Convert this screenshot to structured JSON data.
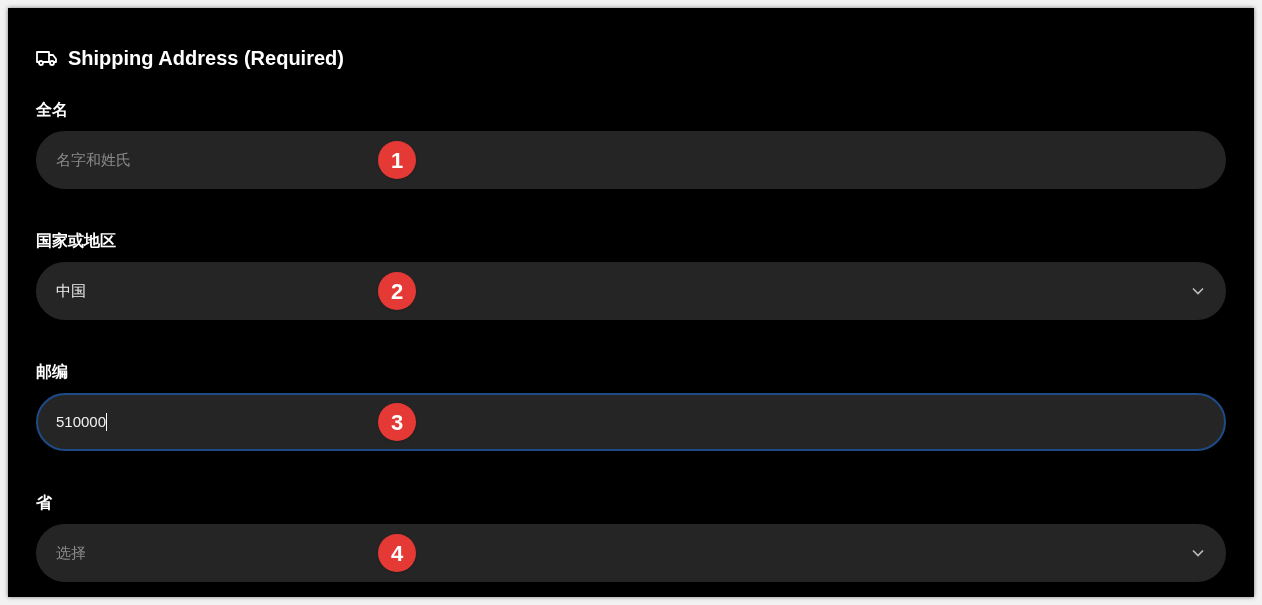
{
  "section": {
    "title": "Shipping Address (Required)"
  },
  "fields": [
    {
      "label": "全名",
      "kind": "text",
      "placeholder": "名字和姓氏",
      "focused": false,
      "marker": "1"
    },
    {
      "label": "国家或地区",
      "kind": "select",
      "value": "中国",
      "focused": false,
      "marker": "2"
    },
    {
      "label": "邮编",
      "kind": "text",
      "value": "510000",
      "focused": true,
      "marker": "3"
    },
    {
      "label": "省",
      "kind": "select",
      "placeholder": "选择",
      "focused": false,
      "marker": "4"
    }
  ]
}
